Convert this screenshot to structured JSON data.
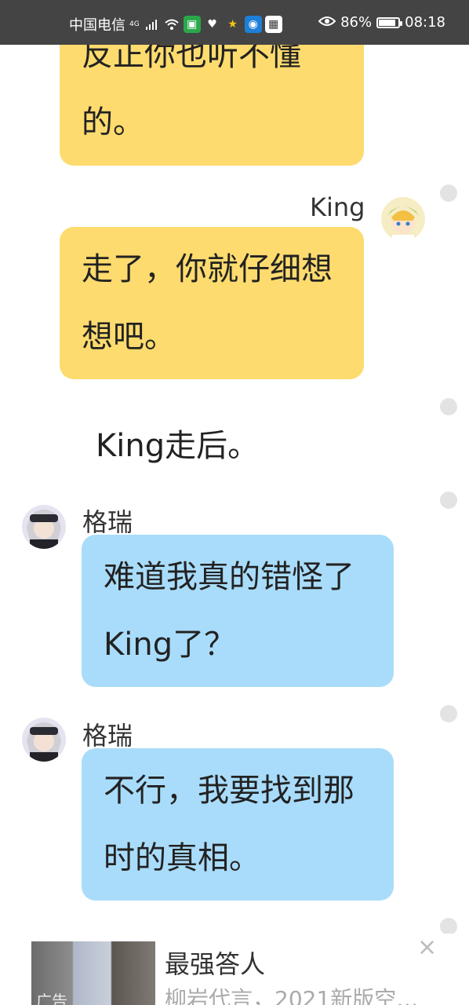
{
  "status_bar": {
    "carrier": "中国电信",
    "network": "4G",
    "battery_percent": "86%",
    "time": "08:18",
    "battery_level": 0.86,
    "icons": [
      "signal-icon",
      "wifi-icon",
      "app-badge-icon",
      "health-icon",
      "star-icon",
      "app-icon",
      "qr-icon",
      "eye-icon",
      "battery-icon"
    ]
  },
  "messages": {
    "m1_text": "反正你也听不懂的。",
    "m2_sender": "King",
    "m2_text": "走了，你就仔细想想吧。",
    "narration": "King走后。",
    "m3_sender": "格瑞",
    "m3_text": "难道我真的错怪了King了？",
    "m4_sender": "格瑞",
    "m4_text": "不行，我要找到那时的真相。"
  },
  "ad": {
    "tag": "广告",
    "title": "最强答人",
    "subtitle": "柳岩代言，2021新版空…",
    "close": "×"
  },
  "colors": {
    "status_bg": "#444444",
    "yellow_bubble": "#fddb6e",
    "blue_bubble": "#a9dcfa",
    "dot": "#e3e3e3"
  }
}
